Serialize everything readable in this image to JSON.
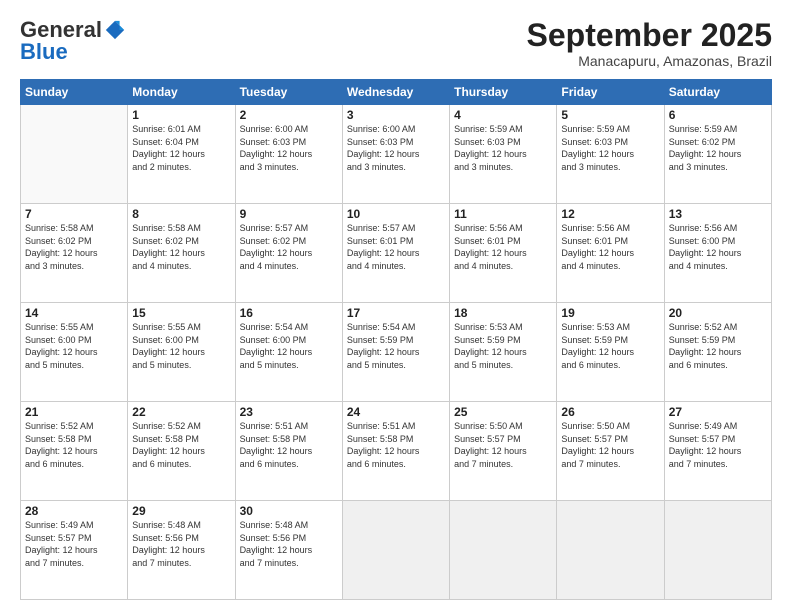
{
  "header": {
    "logo_general": "General",
    "logo_blue": "Blue",
    "month_title": "September 2025",
    "subtitle": "Manacapuru, Amazonas, Brazil"
  },
  "days_of_week": [
    "Sunday",
    "Monday",
    "Tuesday",
    "Wednesday",
    "Thursday",
    "Friday",
    "Saturday"
  ],
  "weeks": [
    [
      {
        "day": "",
        "info": ""
      },
      {
        "day": "1",
        "info": "Sunrise: 6:01 AM\nSunset: 6:04 PM\nDaylight: 12 hours\nand 2 minutes."
      },
      {
        "day": "2",
        "info": "Sunrise: 6:00 AM\nSunset: 6:03 PM\nDaylight: 12 hours\nand 3 minutes."
      },
      {
        "day": "3",
        "info": "Sunrise: 6:00 AM\nSunset: 6:03 PM\nDaylight: 12 hours\nand 3 minutes."
      },
      {
        "day": "4",
        "info": "Sunrise: 5:59 AM\nSunset: 6:03 PM\nDaylight: 12 hours\nand 3 minutes."
      },
      {
        "day": "5",
        "info": "Sunrise: 5:59 AM\nSunset: 6:03 PM\nDaylight: 12 hours\nand 3 minutes."
      },
      {
        "day": "6",
        "info": "Sunrise: 5:59 AM\nSunset: 6:02 PM\nDaylight: 12 hours\nand 3 minutes."
      }
    ],
    [
      {
        "day": "7",
        "info": "Sunrise: 5:58 AM\nSunset: 6:02 PM\nDaylight: 12 hours\nand 3 minutes."
      },
      {
        "day": "8",
        "info": "Sunrise: 5:58 AM\nSunset: 6:02 PM\nDaylight: 12 hours\nand 4 minutes."
      },
      {
        "day": "9",
        "info": "Sunrise: 5:57 AM\nSunset: 6:02 PM\nDaylight: 12 hours\nand 4 minutes."
      },
      {
        "day": "10",
        "info": "Sunrise: 5:57 AM\nSunset: 6:01 PM\nDaylight: 12 hours\nand 4 minutes."
      },
      {
        "day": "11",
        "info": "Sunrise: 5:56 AM\nSunset: 6:01 PM\nDaylight: 12 hours\nand 4 minutes."
      },
      {
        "day": "12",
        "info": "Sunrise: 5:56 AM\nSunset: 6:01 PM\nDaylight: 12 hours\nand 4 minutes."
      },
      {
        "day": "13",
        "info": "Sunrise: 5:56 AM\nSunset: 6:00 PM\nDaylight: 12 hours\nand 4 minutes."
      }
    ],
    [
      {
        "day": "14",
        "info": "Sunrise: 5:55 AM\nSunset: 6:00 PM\nDaylight: 12 hours\nand 5 minutes."
      },
      {
        "day": "15",
        "info": "Sunrise: 5:55 AM\nSunset: 6:00 PM\nDaylight: 12 hours\nand 5 minutes."
      },
      {
        "day": "16",
        "info": "Sunrise: 5:54 AM\nSunset: 6:00 PM\nDaylight: 12 hours\nand 5 minutes."
      },
      {
        "day": "17",
        "info": "Sunrise: 5:54 AM\nSunset: 5:59 PM\nDaylight: 12 hours\nand 5 minutes."
      },
      {
        "day": "18",
        "info": "Sunrise: 5:53 AM\nSunset: 5:59 PM\nDaylight: 12 hours\nand 5 minutes."
      },
      {
        "day": "19",
        "info": "Sunrise: 5:53 AM\nSunset: 5:59 PM\nDaylight: 12 hours\nand 6 minutes."
      },
      {
        "day": "20",
        "info": "Sunrise: 5:52 AM\nSunset: 5:59 PM\nDaylight: 12 hours\nand 6 minutes."
      }
    ],
    [
      {
        "day": "21",
        "info": "Sunrise: 5:52 AM\nSunset: 5:58 PM\nDaylight: 12 hours\nand 6 minutes."
      },
      {
        "day": "22",
        "info": "Sunrise: 5:52 AM\nSunset: 5:58 PM\nDaylight: 12 hours\nand 6 minutes."
      },
      {
        "day": "23",
        "info": "Sunrise: 5:51 AM\nSunset: 5:58 PM\nDaylight: 12 hours\nand 6 minutes."
      },
      {
        "day": "24",
        "info": "Sunrise: 5:51 AM\nSunset: 5:58 PM\nDaylight: 12 hours\nand 6 minutes."
      },
      {
        "day": "25",
        "info": "Sunrise: 5:50 AM\nSunset: 5:57 PM\nDaylight: 12 hours\nand 7 minutes."
      },
      {
        "day": "26",
        "info": "Sunrise: 5:50 AM\nSunset: 5:57 PM\nDaylight: 12 hours\nand 7 minutes."
      },
      {
        "day": "27",
        "info": "Sunrise: 5:49 AM\nSunset: 5:57 PM\nDaylight: 12 hours\nand 7 minutes."
      }
    ],
    [
      {
        "day": "28",
        "info": "Sunrise: 5:49 AM\nSunset: 5:57 PM\nDaylight: 12 hours\nand 7 minutes."
      },
      {
        "day": "29",
        "info": "Sunrise: 5:48 AM\nSunset: 5:56 PM\nDaylight: 12 hours\nand 7 minutes."
      },
      {
        "day": "30",
        "info": "Sunrise: 5:48 AM\nSunset: 5:56 PM\nDaylight: 12 hours\nand 7 minutes."
      },
      {
        "day": "",
        "info": ""
      },
      {
        "day": "",
        "info": ""
      },
      {
        "day": "",
        "info": ""
      },
      {
        "day": "",
        "info": ""
      }
    ]
  ]
}
